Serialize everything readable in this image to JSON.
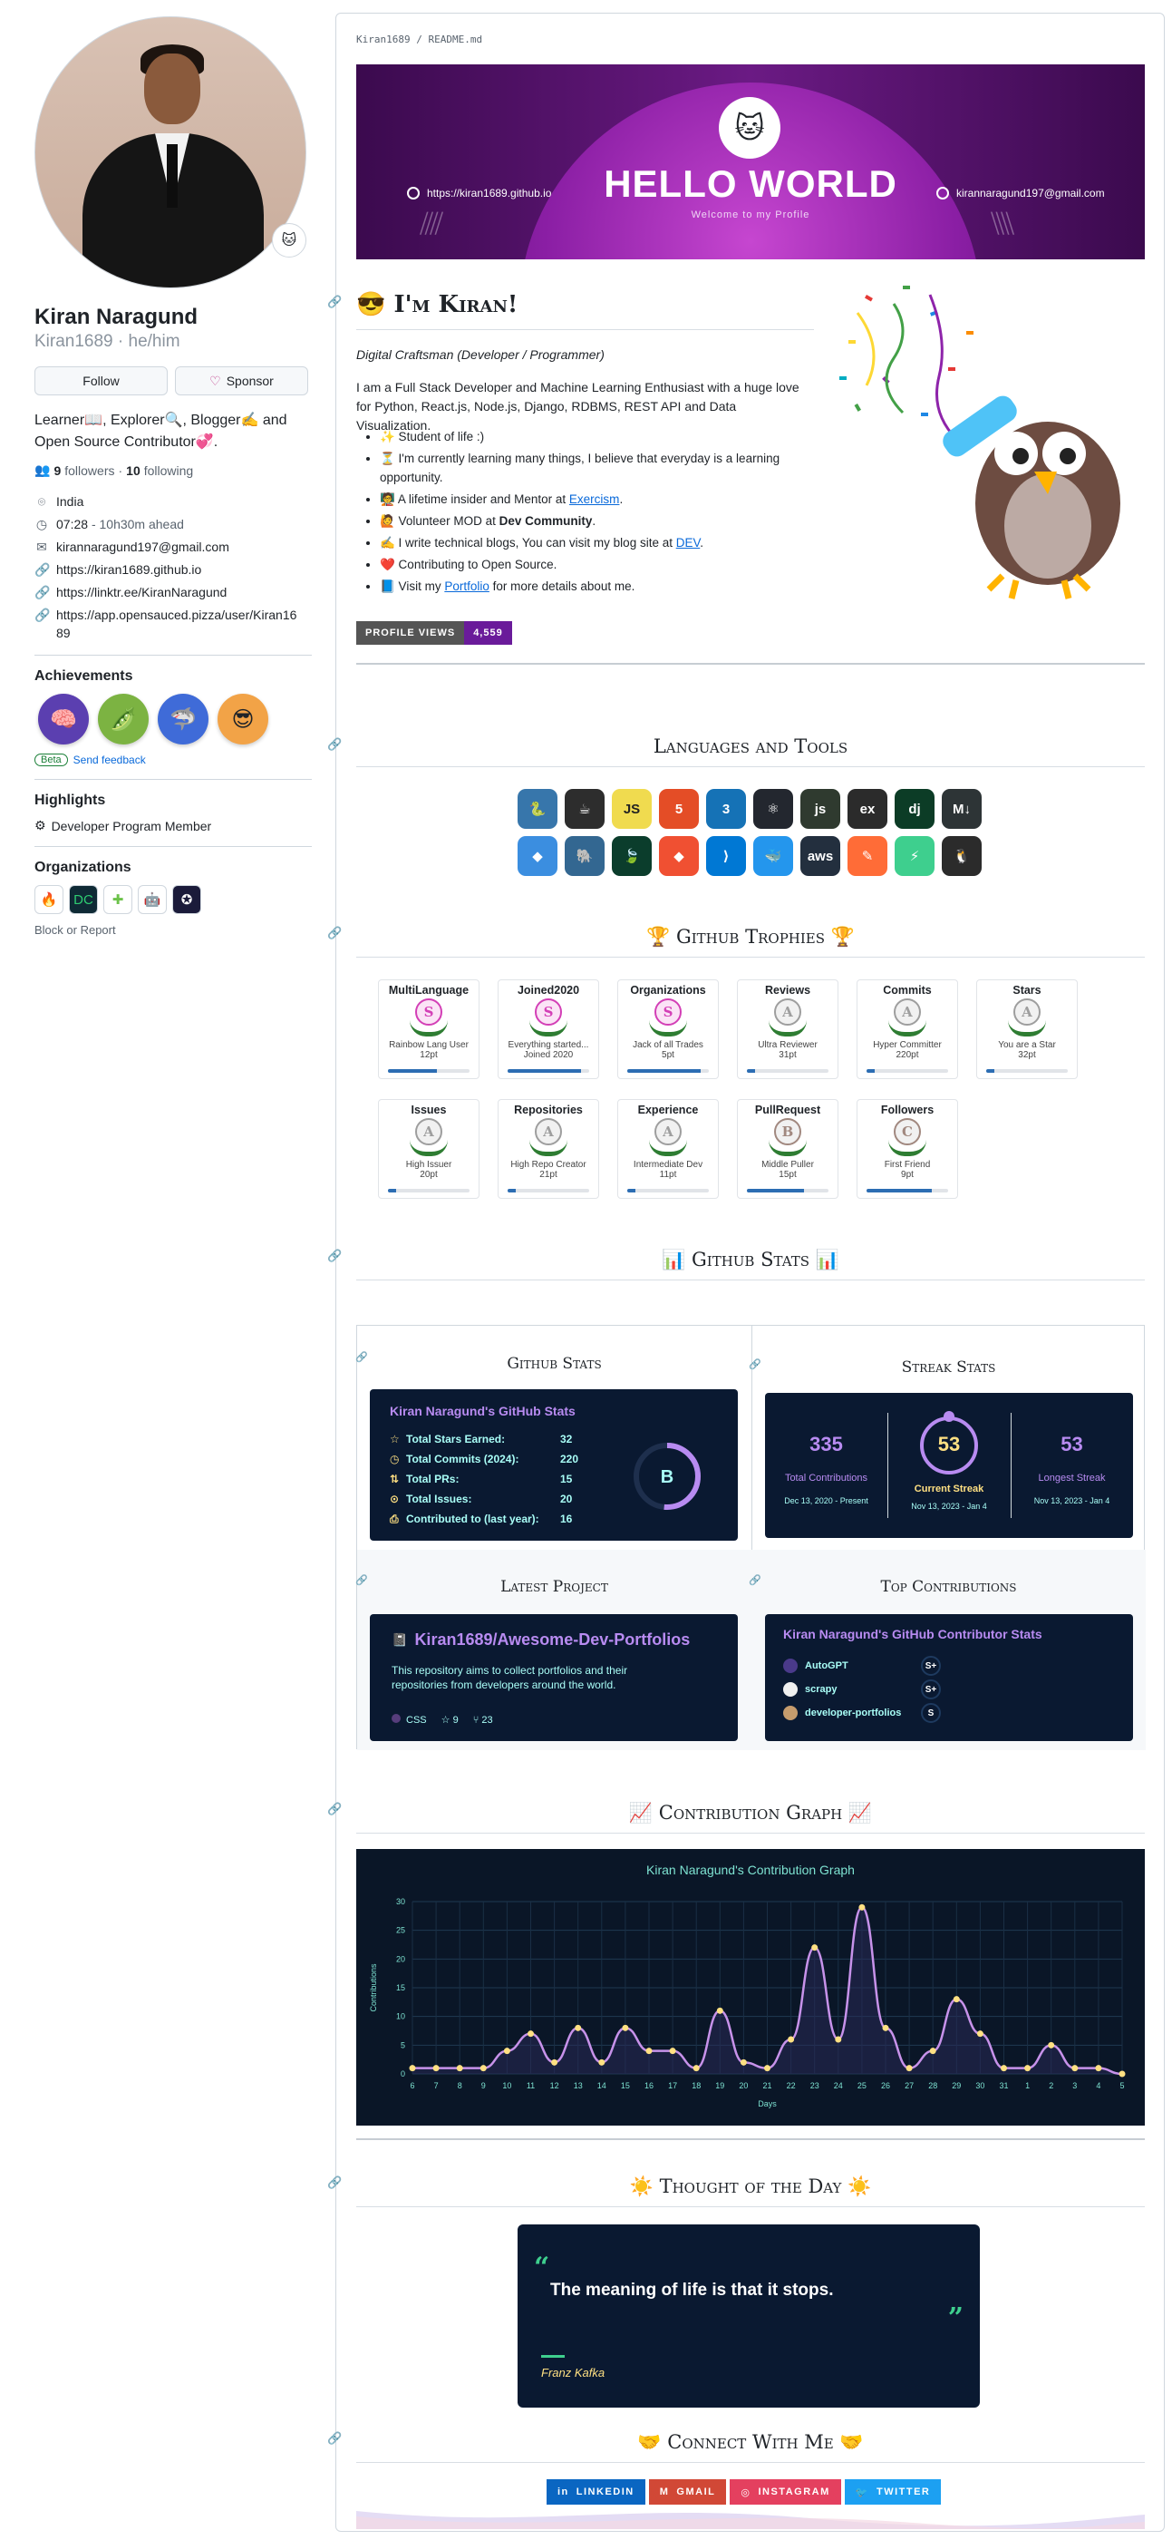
{
  "sidebar": {
    "fullname": "Kiran Naragund",
    "username": "Kiran1689",
    "pronouns": "he/him",
    "follow_label": "Follow",
    "sponsor_label": "Sponsor",
    "bio": "Learner📖, Explorer🔍, Blogger✍️ and Open Source Contributor💞.",
    "followers": "9",
    "followers_label": "followers",
    "following": "10",
    "following_label": "following",
    "location": "India",
    "time": "07:28",
    "time_note": "10h30m ahead",
    "email": "kirannaragund197@gmail.com",
    "links": [
      "https://kiran1689.github.io",
      "https://linktr.ee/KiranNaragund",
      "https://app.opensauced.pizza/user/Kiran1689"
    ],
    "achievements_title": "Achievements",
    "beta": "Beta",
    "feedback": "Send feedback",
    "highlights_title": "Highlights",
    "highlight": "Developer Program Member",
    "orgs_title": "Organizations",
    "block": "Block or Report"
  },
  "readme": {
    "path_user": "Kiran1689",
    "path_sep": "/",
    "path_file": "README.md",
    "banner": {
      "hello": "HELLO WORLD",
      "sub": "Welcome to my Profile",
      "site": "https://kiran1689.github.io",
      "email": "kirannaragund197@gmail.com"
    },
    "intro_title": "I'm Kiran!",
    "tagline": "Digital Craftsman (Developer / Programmer)",
    "intro": "I am a Full Stack Developer and Machine Learning Enthusiast with a huge love for Python, React.js, Node.js, Django, RDBMS, REST API and Data Visualization.",
    "bullets": [
      {
        "pre": "✨ Student of life :)",
        "link": "",
        "post": ""
      },
      {
        "pre": "⏳ I'm currently learning many things, I believe that everyday is a learning opportunity.",
        "link": "",
        "post": ""
      },
      {
        "pre": "🧑‍🏫 A lifetime insider and Mentor at ",
        "link": "Exercism",
        "post": "."
      },
      {
        "pre": "🙋 Volunteer MOD at ",
        "bold": "Dev Community",
        "post": "."
      },
      {
        "pre": "✍️ I write technical blogs, You can visit my blog site at ",
        "link": "DEV",
        "post": "."
      },
      {
        "pre": "❤️ Contributing to Open Source.",
        "link": "",
        "post": ""
      },
      {
        "pre": "📘 Visit my ",
        "link": "Portfolio",
        "post": " for more details about me."
      }
    ],
    "views_label": "PROFILE VIEWS",
    "views_value": "4,559",
    "languages_title": "Languages and Tools",
    "tools": [
      {
        "name": "python",
        "glyph": "🐍",
        "color": "#3776ab"
      },
      {
        "name": "java",
        "glyph": "☕",
        "color": "#2d2d2d"
      },
      {
        "name": "javascript",
        "glyph": "JS",
        "color": "#f0db4f"
      },
      {
        "name": "html5",
        "glyph": "5",
        "color": "#e44d26"
      },
      {
        "name": "css3",
        "glyph": "3",
        "color": "#1572b6"
      },
      {
        "name": "react",
        "glyph": "⚛",
        "color": "#23272f"
      },
      {
        "name": "nodejs",
        "glyph": "js",
        "color": "#2f3a2f"
      },
      {
        "name": "express",
        "glyph": "ex",
        "color": "#2b2b2b"
      },
      {
        "name": "django",
        "glyph": "dj",
        "color": "#0c3c26"
      },
      {
        "name": "markdown",
        "glyph": "M↓",
        "color": "#2d3436"
      },
      {
        "name": "swift",
        "glyph": "◆",
        "color": "#3b8ee0"
      },
      {
        "name": "postgresql",
        "glyph": "🐘",
        "color": "#336791"
      },
      {
        "name": "mongodb",
        "glyph": "🍃",
        "color": "#0b3d2c"
      },
      {
        "name": "git",
        "glyph": "◆",
        "color": "#f05032"
      },
      {
        "name": "vscode",
        "glyph": "⟩",
        "color": "#0078d4"
      },
      {
        "name": "docker",
        "glyph": "🐳",
        "color": "#2496ed"
      },
      {
        "name": "aws",
        "glyph": "aws",
        "color": "#232f3e"
      },
      {
        "name": "postman",
        "glyph": "✎",
        "color": "#ff6c37"
      },
      {
        "name": "supabase",
        "glyph": "⚡",
        "color": "#3ecf8e"
      },
      {
        "name": "linux",
        "glyph": "🐧",
        "color": "#2b2b2b"
      }
    ],
    "trophies_title": "Github Trophies",
    "trophies": [
      {
        "title": "MultiLanguage",
        "rank": "S",
        "name": "Rainbow Lang User",
        "pts": "12pt",
        "fill": 0.6,
        "color": "#d33fb6"
      },
      {
        "title": "Joined2020",
        "rank": "S",
        "name": "Everything started...",
        "sub": "Joined 2020",
        "fill": 0.9,
        "color": "#d33fb6"
      },
      {
        "title": "Organizations",
        "rank": "S",
        "name": "Jack of all Trades",
        "pts": "5pt",
        "fill": 0.9,
        "color": "#d33fb6"
      },
      {
        "title": "Reviews",
        "rank": "A",
        "name": "Ultra Reviewer",
        "pts": "31pt",
        "fill": 0.1,
        "color": "#9e9e9e"
      },
      {
        "title": "Commits",
        "rank": "A",
        "name": "Hyper Committer",
        "pts": "220pt",
        "fill": 0.1,
        "color": "#9e9e9e"
      },
      {
        "title": "Stars",
        "rank": "A",
        "name": "You are a Star",
        "pts": "32pt",
        "fill": 0.1,
        "color": "#9e9e9e"
      },
      {
        "title": "Issues",
        "rank": "A",
        "name": "High Issuer",
        "pts": "20pt",
        "fill": 0.1,
        "color": "#9e9e9e"
      },
      {
        "title": "Repositories",
        "rank": "A",
        "name": "High Repo Creator",
        "pts": "21pt",
        "fill": 0.1,
        "color": "#9e9e9e"
      },
      {
        "title": "Experience",
        "rank": "A",
        "name": "Intermediate Dev",
        "pts": "11pt",
        "fill": 0.1,
        "color": "#9e9e9e"
      },
      {
        "title": "PullRequest",
        "rank": "B",
        "name": "Middle Puller",
        "pts": "15pt",
        "fill": 0.7,
        "color": "#a1887f"
      },
      {
        "title": "Followers",
        "rank": "C",
        "name": "First Friend",
        "pts": "9pt",
        "fill": 0.8,
        "color": "#a1887f"
      }
    ],
    "stats_title": "Github Stats",
    "cells": {
      "github_stats": "Github Stats",
      "streak_stats": "Streak Stats",
      "latest_project": "Latest Project",
      "top_contrib": "Top Contributions"
    },
    "gh_card": {
      "title": "Kiran Naragund's GitHub Stats",
      "rows": [
        {
          "label": "Total Stars Earned:",
          "value": "32"
        },
        {
          "label": "Total Commits (2024):",
          "value": "220"
        },
        {
          "label": "Total PRs:",
          "value": "15"
        },
        {
          "label": "Total Issues:",
          "value": "20"
        },
        {
          "label": "Contributed to (last year):",
          "value": "16"
        }
      ],
      "grade": "B"
    },
    "streak": {
      "total": "335",
      "total_label": "Total Contributions",
      "total_range": "Dec 13, 2020 - Present",
      "current": "53",
      "current_label": "Current Streak",
      "current_range": "Nov 13, 2023 - Jan 4",
      "longest": "53",
      "longest_label": "Longest Streak",
      "longest_range": "Nov 13, 2023 - Jan 4"
    },
    "project": {
      "name": "Kiran1689/Awesome-Dev-Portfolios",
      "desc": "This repository aims to collect portfolios and their repositories from developers around the world.",
      "lang": "CSS",
      "stars": "9",
      "forks": "23"
    },
    "contrib": {
      "title": "Kiran Naragund's GitHub Contributor Stats",
      "rows": [
        {
          "repo": "AutoGPT",
          "rank": "S+"
        },
        {
          "repo": "scrapy",
          "rank": "S+"
        },
        {
          "repo": "developer-portfolios",
          "rank": "S"
        }
      ]
    },
    "graph_title": "Contribution Graph",
    "quote_title": "Thought of the Day",
    "quote": {
      "text": "The meaning of life is that it stops.",
      "author": "Franz Kafka"
    },
    "connect_title": "Connect With Me",
    "connect": [
      {
        "label": "LINKEDIN",
        "color": "#0a66c2",
        "icon": "in"
      },
      {
        "label": "GMAIL",
        "color": "#d14836",
        "icon": "M"
      },
      {
        "label": "INSTAGRAM",
        "color": "#e4405f",
        "icon": "◎"
      },
      {
        "label": "TWITTER",
        "color": "#1ca0f2",
        "icon": "🐦"
      }
    ]
  },
  "chart_data": {
    "type": "line",
    "title": "Kiran Naragund's Contribution Graph",
    "xlabel": "Days",
    "ylabel": "Contributions",
    "x": [
      "6",
      "7",
      "8",
      "9",
      "10",
      "11",
      "12",
      "13",
      "14",
      "15",
      "16",
      "17",
      "18",
      "19",
      "20",
      "21",
      "22",
      "23",
      "24",
      "25",
      "26",
      "27",
      "28",
      "29",
      "30",
      "31",
      "1",
      "2",
      "3",
      "4",
      "5"
    ],
    "values": [
      1,
      1,
      1,
      1,
      4,
      7,
      2,
      8,
      2,
      8,
      4,
      4,
      1,
      11,
      2,
      1,
      6,
      22,
      6,
      29,
      8,
      1,
      4,
      13,
      7,
      1,
      1,
      5,
      1,
      1,
      0
    ],
    "ylim": [
      0,
      30
    ],
    "yticks": [
      0,
      5,
      10,
      15,
      20,
      25,
      30
    ],
    "grid": true
  }
}
